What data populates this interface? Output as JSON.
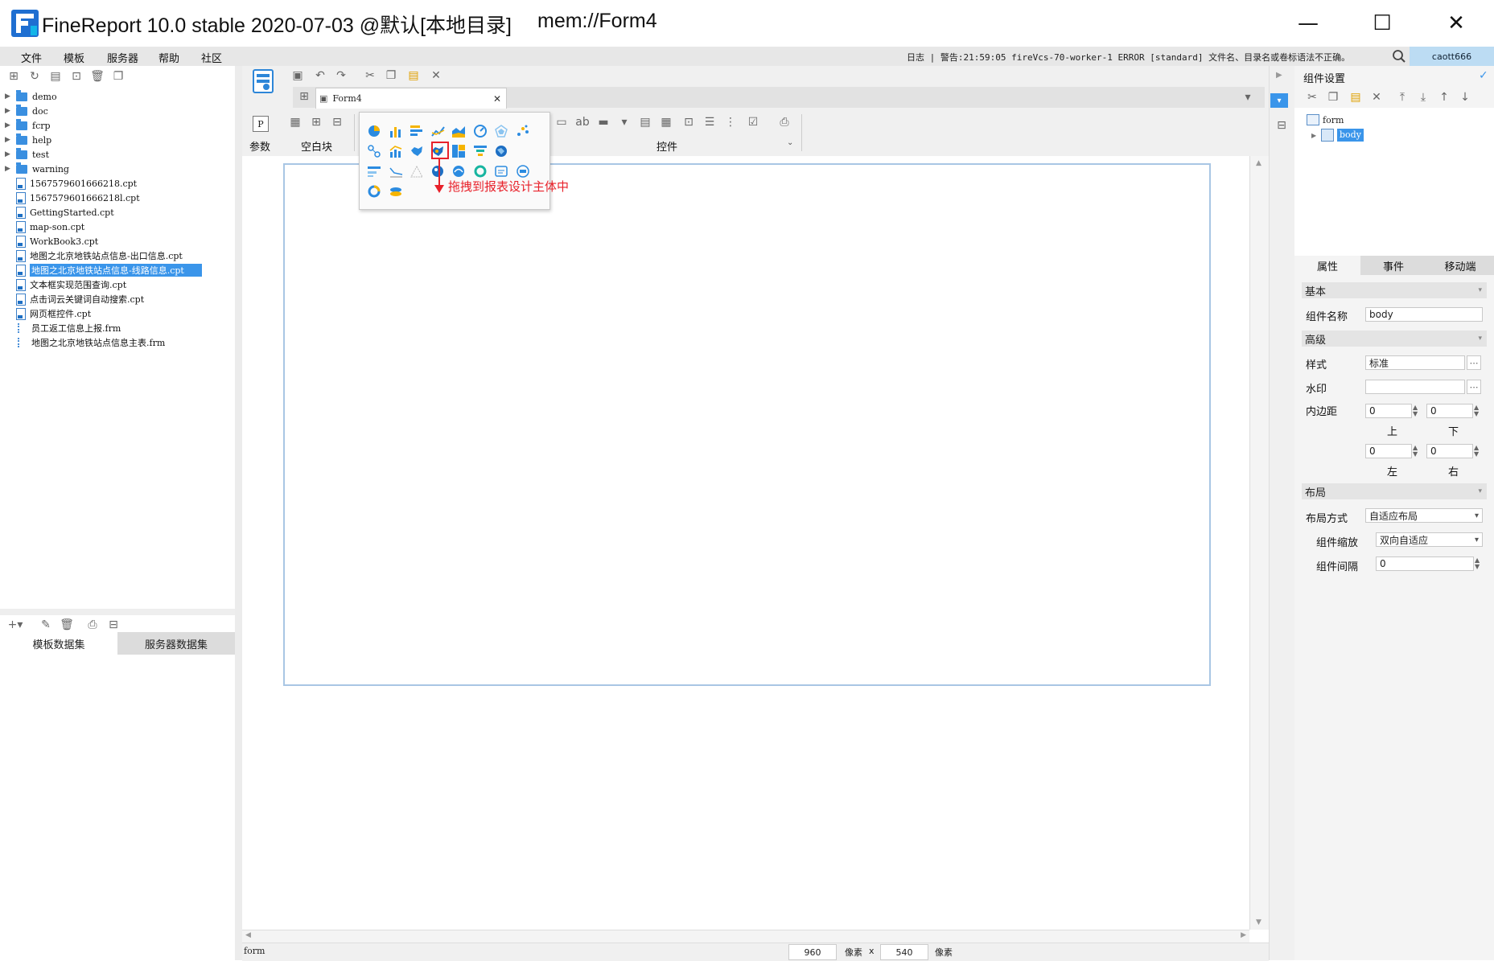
{
  "window": {
    "title": "FineReport 10.0 stable 2020-07-03 @默认[本地目录]",
    "path": "mem://Form4",
    "minimize": "—",
    "maximize": "☐",
    "close": "✕"
  },
  "menu": [
    "文件",
    "模板",
    "服务器",
    "帮助",
    "社区"
  ],
  "log_message": "日志 | 警告:21:59:05 fireVcs-70-worker-1 ERROR [standard] 文件名、目录名或卷标语法不正确。",
  "user": "caott666",
  "file_tree": {
    "folders": [
      "demo",
      "doc",
      "fcrp",
      "help",
      "test",
      "warning"
    ],
    "files": [
      {
        "name": "1567579601666218.cpt",
        "type": "cpt"
      },
      {
        "name": "1567579601666218l.cpt",
        "type": "cpt"
      },
      {
        "name": "GettingStarted.cpt",
        "type": "cpt"
      },
      {
        "name": "map-son.cpt",
        "type": "cpt"
      },
      {
        "name": "WorkBook3.cpt",
        "type": "cpt"
      },
      {
        "name": "地图之北京地铁站点信息-出口信息.cpt",
        "type": "cpt"
      },
      {
        "name": "地图之北京地铁站点信息-线路信息.cpt",
        "type": "cpt",
        "selected": true
      },
      {
        "name": "文本框实现范围查询.cpt",
        "type": "cpt"
      },
      {
        "name": "点击词云关键词自动搜索.cpt",
        "type": "cpt"
      },
      {
        "name": "网页框控件.cpt",
        "type": "cpt"
      },
      {
        "name": "员工返工信息上报.frm",
        "type": "frm"
      },
      {
        "name": "地图之北京地铁站点信息主表.frm",
        "type": "frm"
      }
    ]
  },
  "dataset_tabs": [
    "模板数据集",
    "服务器数据集"
  ],
  "editor": {
    "tab_name": "Form4",
    "groups": {
      "param": "参数",
      "blank": "空白块",
      "widgets": "控件"
    },
    "param_icon": "P"
  },
  "annotation": "拖拽到报表设计主体中",
  "status": {
    "component": "form",
    "width": "960",
    "unit1": "像素",
    "x": "x",
    "height": "540",
    "unit2": "像素"
  },
  "right_panel": {
    "title": "组件设置",
    "tree": {
      "root": "form",
      "child": "body"
    },
    "tabs": [
      "属性",
      "事件",
      "移动端"
    ],
    "basic": {
      "header": "基本",
      "name_label": "组件名称",
      "name_value": "body"
    },
    "advanced": {
      "header": "高级",
      "style_label": "样式",
      "style_value": "标准",
      "watermark_label": "水印",
      "watermark_value": "",
      "padding_label": "内边距",
      "top": "0",
      "bottom": "0",
      "left": "0",
      "right": "0",
      "top_label": "上",
      "bottom_label": "下",
      "left_label": "左",
      "right_label": "右"
    },
    "layout": {
      "header": "布局",
      "mode_label": "布局方式",
      "mode_value": "自适应布局",
      "scale_label": "组件缩放",
      "scale_value": "双向自适应",
      "gap_label": "组件间隔",
      "gap_value": "0"
    }
  },
  "colors": {
    "accent": "#3a95ea",
    "annotation": "#e8212a",
    "frame": "#a9c6e4"
  }
}
